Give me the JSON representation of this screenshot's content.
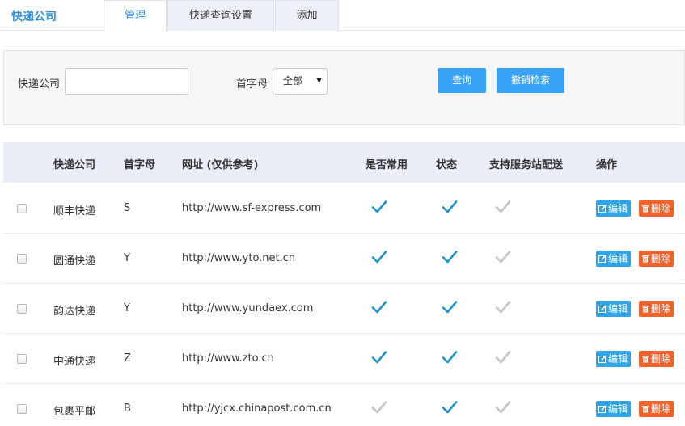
{
  "nav": {
    "brand": "快递公司",
    "tabs": [
      {
        "label": "管理",
        "active": true
      },
      {
        "label": "快递查询设置",
        "active": false
      },
      {
        "label": "添加",
        "active": false
      }
    ]
  },
  "search": {
    "company_label": "快递公司",
    "company_value": "",
    "letter_label": "首字母",
    "letter_selected": "全部",
    "query_button": "查询",
    "reset_button": "撤销检索"
  },
  "table": {
    "headers": {
      "company": "快递公司",
      "letter": "首字母",
      "url": "网址 (仅供参考)",
      "common": "是否常用",
      "status": "状态",
      "station": "支持服务站配送",
      "ops": "操作"
    },
    "edit_label": "编辑",
    "delete_label": "删除",
    "rows": [
      {
        "name": "顺丰快递",
        "letter": "S",
        "url": "http://www.sf-express.com",
        "common": true,
        "status": true,
        "station": false
      },
      {
        "name": "圆通快递",
        "letter": "Y",
        "url": "http://www.yto.net.cn",
        "common": true,
        "status": true,
        "station": false
      },
      {
        "name": "韵达快递",
        "letter": "Y",
        "url": "http://www.yundaex.com",
        "common": true,
        "status": true,
        "station": false
      },
      {
        "name": "中通快递",
        "letter": "Z",
        "url": "http://www.zto.cn",
        "common": true,
        "status": true,
        "station": false
      },
      {
        "name": "包裹平邮",
        "letter": "B",
        "url": "http://yjcx.chinapost.com.cn",
        "common": false,
        "status": true,
        "station": false
      }
    ]
  },
  "colors": {
    "accent": "#2f8fd9",
    "check_on": "#1f93c9",
    "check_off": "#c4c4c4",
    "edit": "#2fa4e7",
    "delete": "#f0622c"
  }
}
